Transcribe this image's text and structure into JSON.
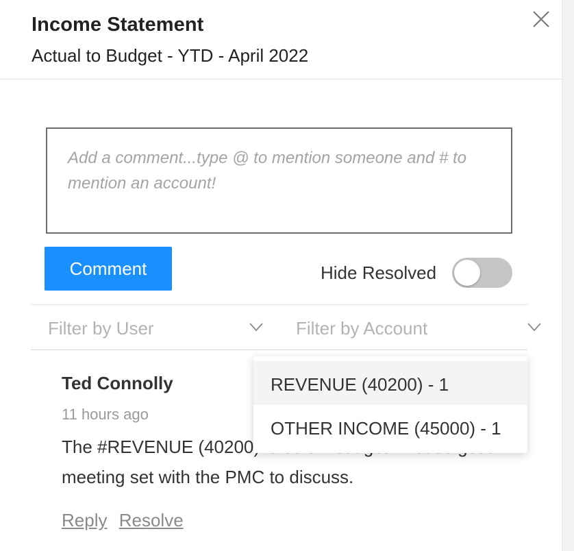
{
  "header": {
    "title": "Income Statement",
    "subtitle": "Actual to Budget - YTD - April 2022"
  },
  "comment_input": {
    "placeholder": "Add a comment...type @ to mention someone and # to mention an account!",
    "value": ""
  },
  "comment_button": {
    "label": "Comment"
  },
  "hide_resolved": {
    "label": "Hide Resolved",
    "on": false
  },
  "filters": {
    "user": {
      "placeholder": "Filter by User"
    },
    "account": {
      "placeholder": "Filter by Account"
    }
  },
  "account_dropdown": {
    "options": [
      {
        "label": "REVENUE (40200) - 1",
        "highlighted": true
      },
      {
        "label": "OTHER INCOME (45000) - 1",
        "highlighted": false
      }
    ]
  },
  "comments": [
    {
      "author": "Ted Connolly",
      "time": "11 hours ago",
      "text": "The #REVENUE (40200) is below budget. Please get a meeting set with the PMC to discuss.",
      "actions": {
        "reply": "Reply",
        "resolve": "Resolve"
      }
    }
  ],
  "colors": {
    "accent": "#1a90ff",
    "toggle_off": "#c5c5c5",
    "placeholder": "#b3b3b3",
    "muted_text": "#9a9a9a"
  },
  "icons": {
    "close": "close-icon",
    "chevron": "chevron-down-icon"
  }
}
